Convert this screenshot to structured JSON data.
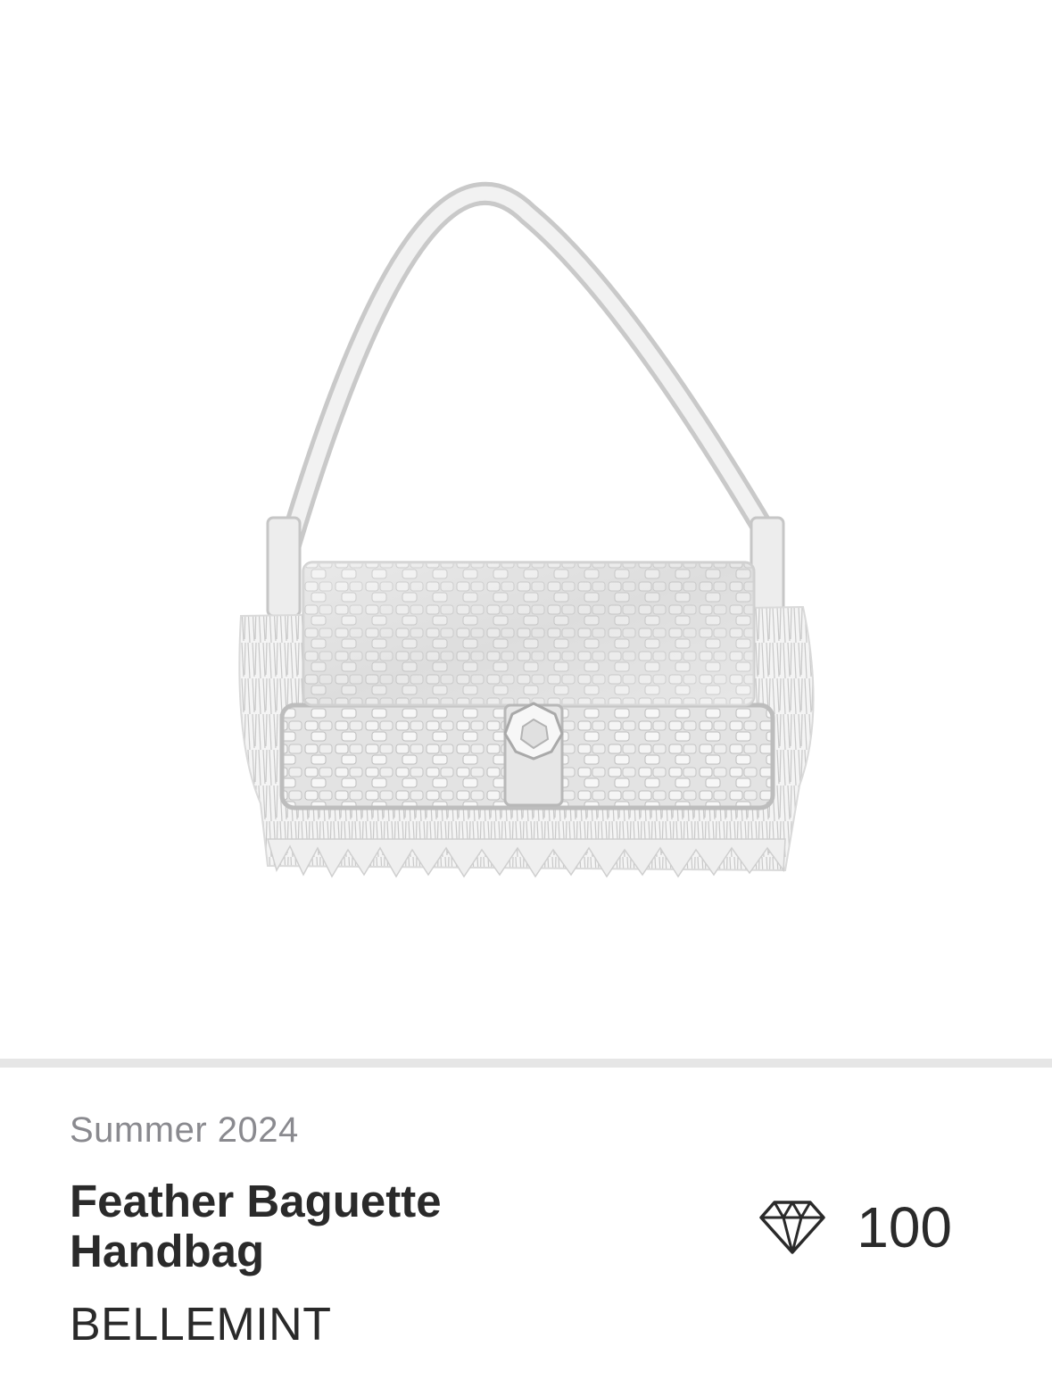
{
  "product": {
    "image_alt": "Silver feather baguette handbag",
    "collection": "Summer 2024",
    "title": "Feather Baguette Handbag",
    "brand": "BELLEMINT",
    "price_icon": "diamond-icon",
    "price": "100"
  },
  "colors": {
    "divider": "#e6e6e6",
    "muted_text": "#8a8a8f",
    "primary_text": "#2a2a2a",
    "bag_silver": "#d9d9d9"
  }
}
